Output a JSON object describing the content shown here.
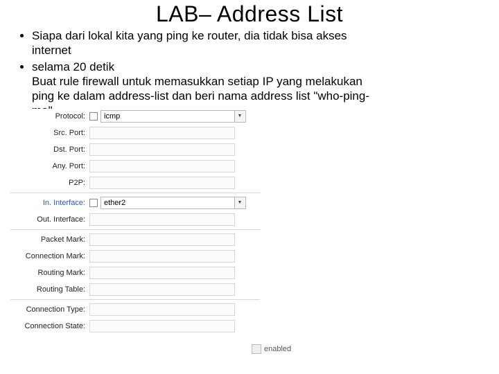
{
  "title": "LAB– Address List",
  "bullets": {
    "b1_line1": "Siapa dari lokal kita yang ping ke router, dia tidak bisa akses",
    "b1_line2": "internet",
    "b2_line1": "selama 20 detik",
    "b2_line2": "Buat rule firewall untuk memasukkan setiap IP yang melakukan",
    "b2_line3": "ping ke dalam address-list dan beri nama address list \"who-ping-",
    "b2_line4": "me\"."
  },
  "form": {
    "rows": {
      "protocol": {
        "label": "Protocol:",
        "value": "icmp"
      },
      "src_port": {
        "label": "Src. Port:",
        "value": ""
      },
      "dst_port": {
        "label": "Dst. Port:",
        "value": ""
      },
      "any_port": {
        "label": "Any. Port:",
        "value": ""
      },
      "p2p": {
        "label": "P2P:",
        "value": ""
      },
      "in_int": {
        "label": "In. Interface:",
        "value": "ether2"
      },
      "out_int": {
        "label": "Out. Interface:",
        "value": ""
      },
      "pkt_mark": {
        "label": "Packet Mark:",
        "value": ""
      },
      "con_mark": {
        "label": "Connection Mark:",
        "value": ""
      },
      "rt_mark": {
        "label": "Routing Mark:",
        "value": ""
      },
      "rt_table": {
        "label": "Routing Table:",
        "value": ""
      },
      "con_type": {
        "label": "Connection Type:",
        "value": ""
      },
      "con_state": {
        "label": "Connection State:",
        "value": ""
      }
    },
    "footer": "enabled"
  },
  "chart_data": {
    "type": "table"
  }
}
